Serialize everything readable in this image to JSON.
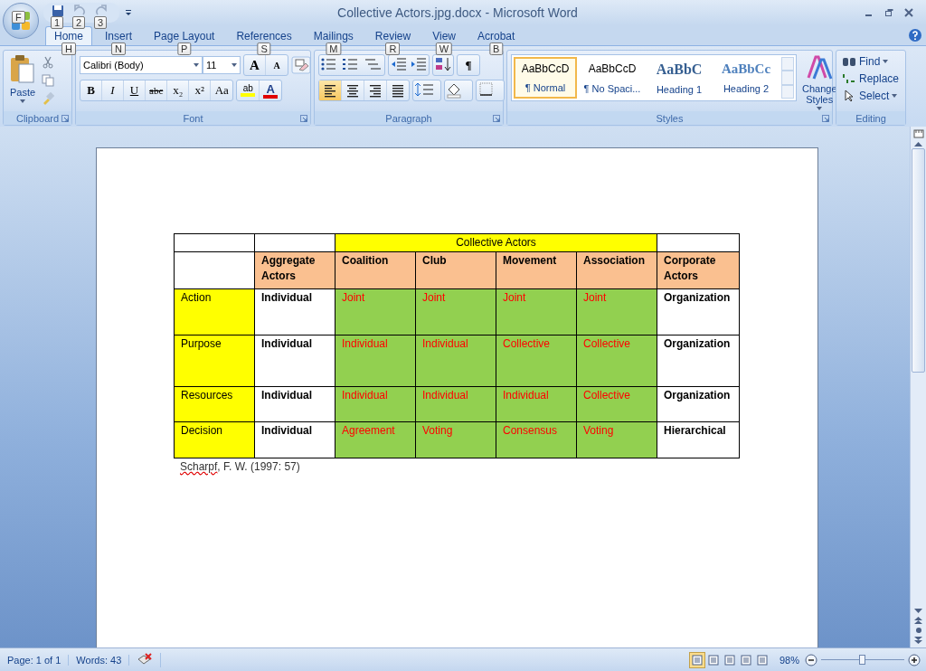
{
  "window": {
    "title": "Collective Actors.jpg.docx - Microsoft Word",
    "office_keytip": "F",
    "quick_access_keytips": [
      "1",
      "2",
      "3"
    ]
  },
  "tabs": [
    {
      "label": "Home",
      "keytip": "H",
      "selected": true
    },
    {
      "label": "Insert",
      "keytip": "N",
      "selected": false
    },
    {
      "label": "Page Layout",
      "keytip": "P",
      "selected": false
    },
    {
      "label": "References",
      "keytip": "S",
      "selected": false
    },
    {
      "label": "Mailings",
      "keytip": "M",
      "selected": false
    },
    {
      "label": "Review",
      "keytip": "R",
      "selected": false
    },
    {
      "label": "View",
      "keytip": "W",
      "selected": false
    },
    {
      "label": "Acrobat",
      "keytip": "B",
      "selected": false
    }
  ],
  "ribbon": {
    "clipboard": {
      "label": "Clipboard",
      "paste": "Paste"
    },
    "font": {
      "label": "Font",
      "family": "Calibri (Body)",
      "size": "11",
      "grow": "A",
      "shrink": "A",
      "format_buttons": [
        {
          "label": "B",
          "kind": "bold"
        },
        {
          "label": "I",
          "kind": "italic"
        },
        {
          "label": "U",
          "kind": "underline"
        },
        {
          "label": "abc",
          "kind": "strike"
        },
        {
          "label": "x₂",
          "kind": "sub"
        },
        {
          "label": "x²",
          "kind": "sup"
        },
        {
          "label": "Aa",
          "kind": "case"
        }
      ],
      "highlight": "ab",
      "font_color": "A"
    },
    "paragraph": {
      "label": "Paragraph",
      "pilcrow": "¶",
      "alignments": [
        {
          "kind": "left",
          "selected": true
        },
        {
          "kind": "center",
          "selected": false
        },
        {
          "kind": "right",
          "selected": false
        },
        {
          "kind": "justify",
          "selected": false
        }
      ]
    },
    "styles": {
      "label": "Styles",
      "items": [
        {
          "preview": "AaBbCcD",
          "name": "¶ Normal",
          "kind": "normal",
          "selected": true
        },
        {
          "preview": "AaBbCcD",
          "name": "¶ No Spaci...",
          "kind": "normal",
          "selected": false
        },
        {
          "preview": "AaBbC",
          "name": "Heading 1",
          "kind": "heading1",
          "selected": false
        },
        {
          "preview": "AaBbCc",
          "name": "Heading 2",
          "kind": "heading2",
          "selected": false
        }
      ],
      "change_styles": "Change Styles"
    },
    "editing": {
      "label": "Editing",
      "find": "Find",
      "replace": "Replace",
      "select": "Select"
    }
  },
  "document": {
    "table": {
      "rows": [
        {
          "cells": [
            {
              "kind": "empty"
            },
            {
              "kind": "empty"
            },
            {
              "text": "Collective Actors",
              "color": "#ffff00",
              "kind": "plain",
              "colspan": 4
            },
            {
              "kind": "empty"
            }
          ]
        },
        {
          "cells": [
            {
              "kind": "empty"
            },
            {
              "text": "Aggregate Actors",
              "color": "#fac090",
              "kind": "bold"
            },
            {
              "text": "Coalition",
              "color": "#fac090",
              "kind": "bold"
            },
            {
              "text": "Club",
              "color": "#fac090",
              "kind": "bold"
            },
            {
              "text": "Movement",
              "color": "#fac090",
              "kind": "bold"
            },
            {
              "text": "Association",
              "color": "#fac090",
              "kind": "bold"
            },
            {
              "text": "Corporate Actors",
              "color": "#fac090",
              "kind": "bold"
            }
          ]
        },
        {
          "cells": [
            {
              "text": "Action",
              "color": "#ffff00",
              "kind": "plain"
            },
            {
              "text": "Individual",
              "color": "#ffffff",
              "kind": "bold"
            },
            {
              "text": "Joint",
              "color": "#92d050",
              "kind": "red"
            },
            {
              "text": "Joint",
              "color": "#92d050",
              "kind": "red"
            },
            {
              "text": "Joint",
              "color": "#92d050",
              "kind": "red"
            },
            {
              "text": "Joint",
              "color": "#92d050",
              "kind": "red"
            },
            {
              "text": "Organization",
              "color": "#ffffff",
              "kind": "bold"
            }
          ]
        },
        {
          "cells": [
            {
              "text": "Purpose",
              "color": "#ffff00",
              "kind": "plain"
            },
            {
              "text": "Individual",
              "color": "#ffffff",
              "kind": "bold"
            },
            {
              "text": "Individual",
              "color": "#92d050",
              "kind": "red"
            },
            {
              "text": "Individual",
              "color": "#92d050",
              "kind": "red"
            },
            {
              "text": "Collective",
              "color": "#92d050",
              "kind": "red"
            },
            {
              "text": "Collective",
              "color": "#92d050",
              "kind": "red"
            },
            {
              "text": "Organization",
              "color": "#ffffff",
              "kind": "bold"
            }
          ]
        },
        {
          "cells": [
            {
              "text": "Resources",
              "color": "#ffff00",
              "kind": "plain"
            },
            {
              "text": "Individual",
              "color": "#ffffff",
              "kind": "bold"
            },
            {
              "text": "Individual",
              "color": "#92d050",
              "kind": "red"
            },
            {
              "text": "Individual",
              "color": "#92d050",
              "kind": "red"
            },
            {
              "text": "Individual",
              "color": "#92d050",
              "kind": "red"
            },
            {
              "text": "Collective",
              "color": "#92d050",
              "kind": "red"
            },
            {
              "text": "Organization",
              "color": "#ffffff",
              "kind": "bold"
            }
          ]
        },
        {
          "cells": [
            {
              "text": "Decision",
              "color": "#ffff00",
              "kind": "plain"
            },
            {
              "text": "Individual",
              "color": "#ffffff",
              "kind": "bold"
            },
            {
              "text": "Agreement",
              "color": "#92d050",
              "kind": "red"
            },
            {
              "text": "Voting",
              "color": "#92d050",
              "kind": "red"
            },
            {
              "text": "Consensus",
              "color": "#92d050",
              "kind": "red"
            },
            {
              "text": "Voting",
              "color": "#92d050",
              "kind": "red"
            },
            {
              "text": "Hierarchical",
              "color": "#ffffff",
              "kind": "bold"
            }
          ]
        }
      ]
    },
    "caption": {
      "misspelled": "Scharpf",
      "rest": ", F. W. (1997: 57)"
    }
  },
  "status_bar": {
    "page": "Page: 1 of 1",
    "words": "Words: 43",
    "views": [
      {
        "selected": true
      },
      {
        "selected": false
      },
      {
        "selected": false
      },
      {
        "selected": false
      },
      {
        "selected": false
      }
    ],
    "zoom": "98%",
    "zoom_slider": {
      "level": 0.5
    }
  }
}
